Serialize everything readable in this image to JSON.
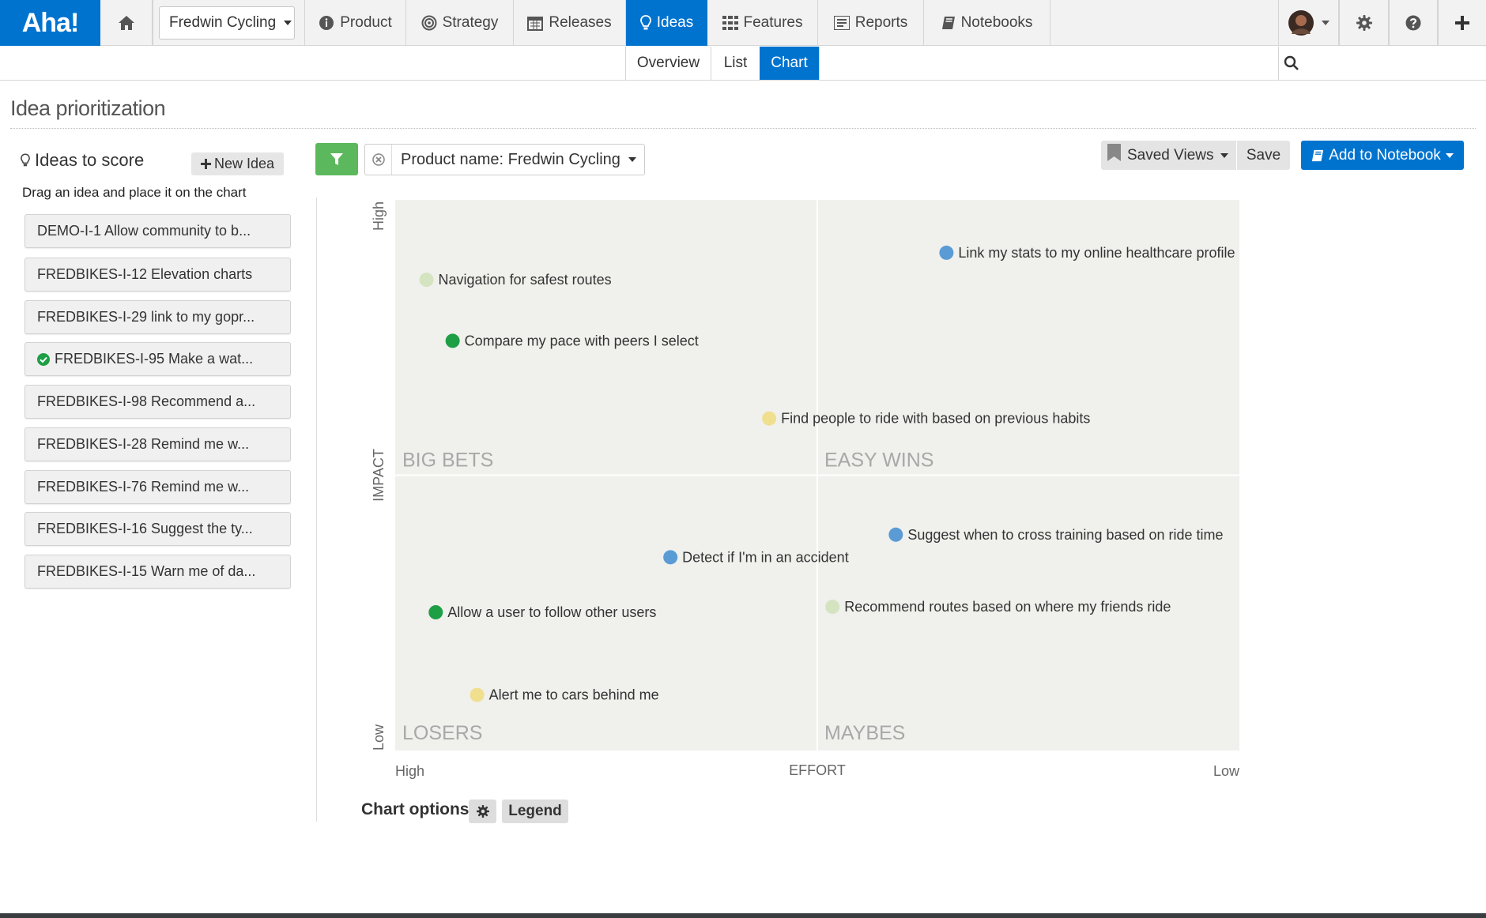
{
  "app": {
    "logo": "Aha!"
  },
  "topnav": {
    "workspace": "Fredwin Cycling",
    "items": [
      {
        "label": "Product",
        "icon": "info-circle-icon"
      },
      {
        "label": "Strategy",
        "icon": "target-icon"
      },
      {
        "label": "Releases",
        "icon": "calendar-icon"
      },
      {
        "label": "Ideas",
        "icon": "lightbulb-icon",
        "active": true
      },
      {
        "label": "Features",
        "icon": "grid-icon"
      },
      {
        "label": "Reports",
        "icon": "report-icon"
      },
      {
        "label": "Notebooks",
        "icon": "book-icon"
      }
    ]
  },
  "subnav": {
    "tabs": [
      "Overview",
      "List",
      "Chart"
    ],
    "active": "Chart"
  },
  "page": {
    "title": "Idea prioritization"
  },
  "sidebar": {
    "title": "Ideas to score",
    "new_idea": "New Idea",
    "hint": "Drag an idea and place it on the chart",
    "ideas": [
      {
        "label": "DEMO-I-1 Allow community to b...",
        "checked": false
      },
      {
        "label": "FREDBIKES-I-12 Elevation charts",
        "checked": false
      },
      {
        "label": "FREDBIKES-I-29 link to my gopr...",
        "checked": false
      },
      {
        "label": "FREDBIKES-I-95 Make a wat...",
        "checked": true
      },
      {
        "label": "FREDBIKES-I-98 Recommend a...",
        "checked": false
      },
      {
        "label": "FREDBIKES-I-28 Remind me w...",
        "checked": false
      },
      {
        "label": "FREDBIKES-I-76 Remind me w...",
        "checked": false
      },
      {
        "label": "FREDBIKES-I-16 Suggest the ty...",
        "checked": false
      },
      {
        "label": "FREDBIKES-I-15 Warn me of da...",
        "checked": false
      }
    ]
  },
  "toolbar": {
    "filter": "Product name: Fredwin Cycling",
    "saved_views": "Saved Views",
    "save": "Save",
    "add_to_notebook": "Add to Notebook"
  },
  "chart_data": {
    "type": "scatter",
    "xlabel": "EFFORT",
    "ylabel": "IMPACT",
    "x_ticks": [
      "High",
      "Low"
    ],
    "y_ticks": [
      "High",
      "Low"
    ],
    "xlim": [
      0,
      100
    ],
    "ylim": [
      0,
      100
    ],
    "quadrants": {
      "top_left": "BIG BETS",
      "top_right": "EASY WINS",
      "bottom_left": "LOSERS",
      "bottom_right": "MAYBES"
    },
    "points": [
      {
        "label": "Link my stats to my online healthcare profile",
        "x": 65.3,
        "y": 90.4,
        "color": "#5b9bd5"
      },
      {
        "label": "Navigation for safest routes",
        "x": 3.7,
        "y": 85.5,
        "color": "#d4e4c0"
      },
      {
        "label": "Compare my pace with peers I select",
        "x": 6.8,
        "y": 74.4,
        "color": "#1e9e45"
      },
      {
        "label": "Find people to ride with based on previous habits",
        "x": 44.3,
        "y": 60.3,
        "color": "#f0df8e"
      },
      {
        "label": "Suggest when to cross training based on ride time",
        "x": 59.3,
        "y": 39.2,
        "color": "#5b9bd5"
      },
      {
        "label": "Detect if I'm in an accident",
        "x": 32.6,
        "y": 35.1,
        "color": "#5b9bd5"
      },
      {
        "label": "Allow a user to follow other users",
        "x": 4.8,
        "y": 25.1,
        "color": "#1e9e45"
      },
      {
        "label": "Recommend routes based on where my friends ride",
        "x": 51.8,
        "y": 26.1,
        "color": "#d4e4c0"
      },
      {
        "label": "Alert me to cars behind me",
        "x": 9.7,
        "y": 10.1,
        "color": "#f0df8e"
      }
    ]
  },
  "chart_footer": {
    "options": "Chart options",
    "legend": "Legend"
  },
  "colors": {
    "brand": "#0073cf",
    "filter": "#5cb85c",
    "quadrant_bg": "#f0f0ed"
  }
}
